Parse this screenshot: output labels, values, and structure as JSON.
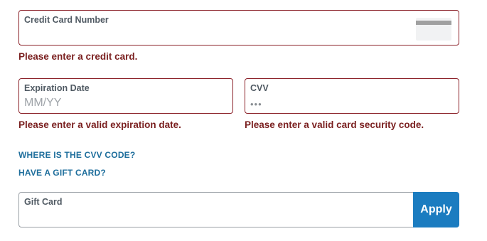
{
  "card_number": {
    "label": "Credit Card Number",
    "value": "",
    "error": "Please enter a credit card.",
    "icon": "credit-card-icon"
  },
  "expiration": {
    "label": "Expiration Date",
    "placeholder": "MM/YY",
    "value": "",
    "error": "Please enter a valid expiration date."
  },
  "cvv": {
    "label": "CVV",
    "placeholder": "•••",
    "value": "",
    "error": "Please enter a valid card security code."
  },
  "links": {
    "cvv_help": "WHERE IS THE CVV CODE?",
    "gift_card": "HAVE A GIFT CARD?"
  },
  "gift_card": {
    "label": "Gift Card",
    "value": "",
    "apply_label": "Apply"
  },
  "colors": {
    "error": "#7a1f1f",
    "error_border": "#8b2129",
    "link": "#1e6e9c",
    "button": "#1b7cc0"
  }
}
